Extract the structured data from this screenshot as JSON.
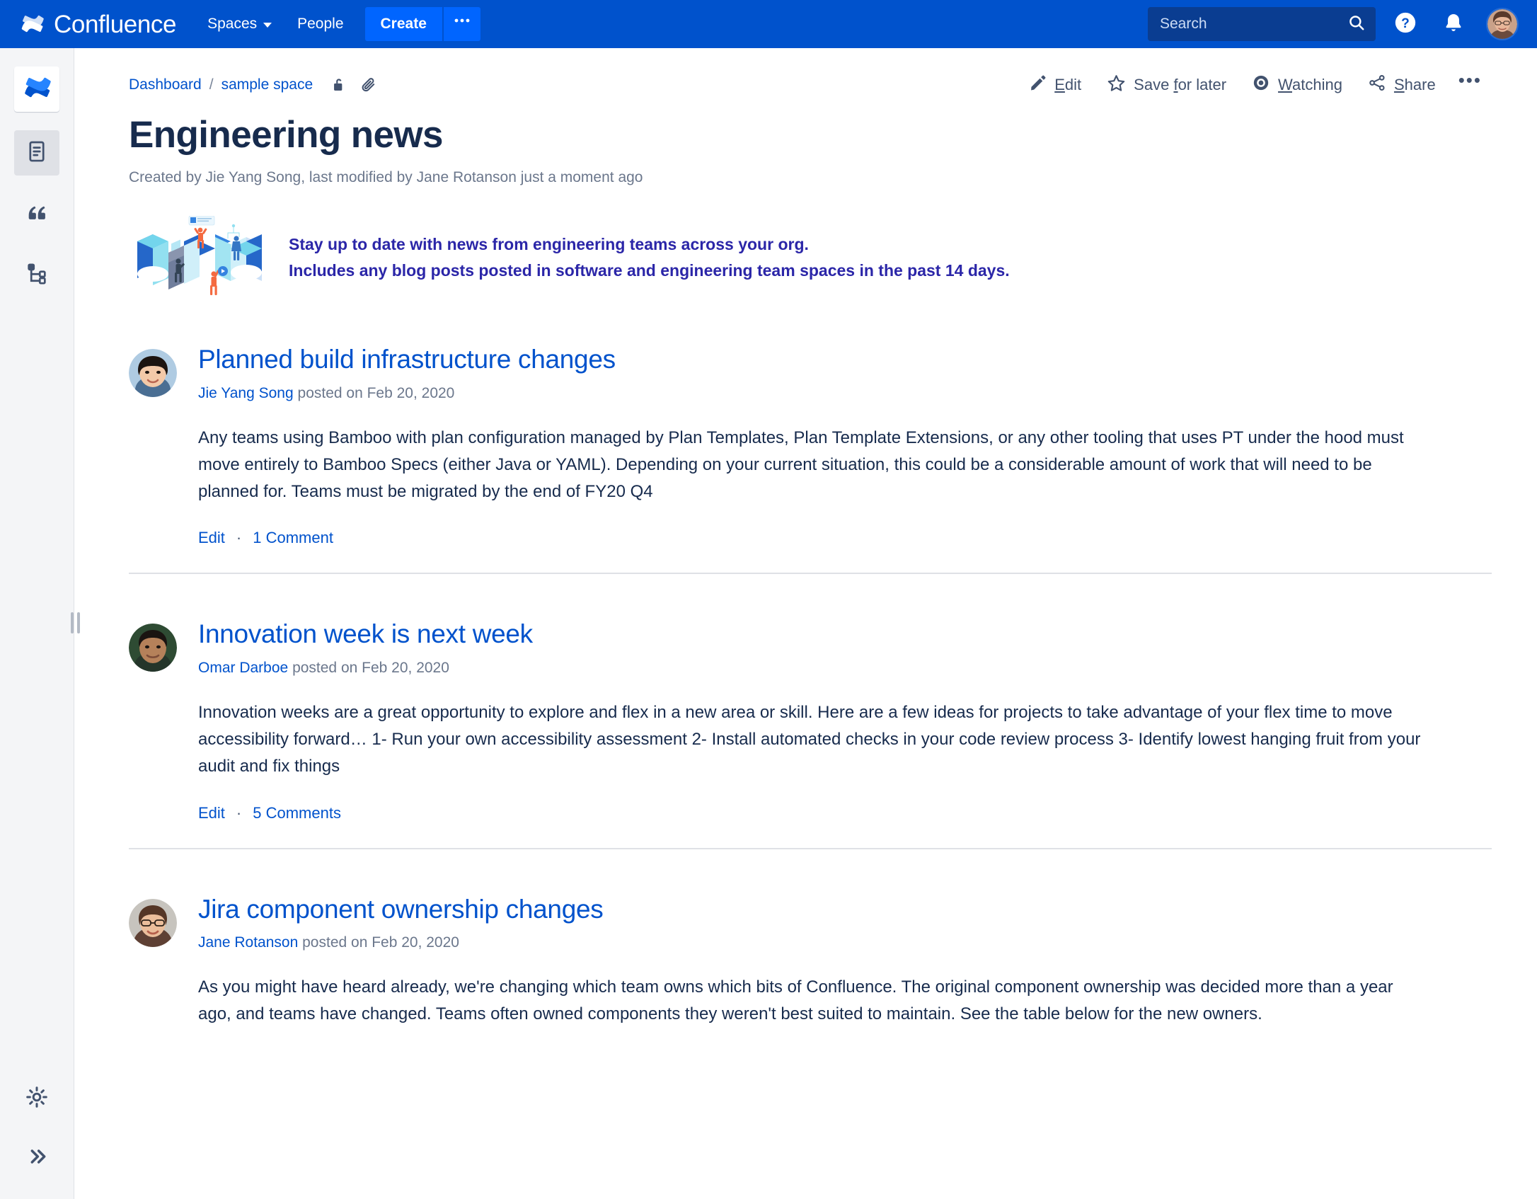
{
  "topnav": {
    "product_name": "Confluence",
    "logo_icon": "confluence-logo-icon",
    "items": [
      {
        "label": "Spaces",
        "has_chevron": true,
        "icon": "chevron-down-icon"
      },
      {
        "label": "People",
        "has_chevron": false
      }
    ],
    "create_label": "Create",
    "create_more_label": "•••",
    "search": {
      "placeholder": "Search",
      "value": "",
      "icon": "search-icon"
    },
    "help_icon": "help-circle-icon",
    "notifications_icon": "notification-bell-icon",
    "avatar_icon": "user-avatar",
    "colors": {
      "bar": "#0052CC",
      "create": "#0065FF",
      "search_field": "#0A3D91"
    }
  },
  "sidebar": {
    "items": [
      {
        "name": "space-home",
        "icon": "confluence-space-logo-icon",
        "selected": false
      },
      {
        "name": "pages",
        "icon": "page-document-icon",
        "selected": true
      },
      {
        "name": "blog",
        "icon": "blog-quote-icon",
        "selected": false
      },
      {
        "name": "page-tree",
        "icon": "page-tree-icon",
        "selected": false
      }
    ],
    "bottom_items": [
      {
        "name": "space-settings",
        "icon": "gear-icon"
      },
      {
        "name": "expand-sidebar",
        "icon": "double-chevron-right-icon"
      }
    ],
    "resize_handle": "sidebar-resize-handle"
  },
  "breadcrumb": {
    "dashboard": "Dashboard",
    "separator": "/",
    "space": "sample space",
    "restrictions_icon": "unlock-icon",
    "attachments_icon": "paperclip-icon"
  },
  "page_actions": [
    {
      "name": "edit",
      "label": "Edit",
      "accesskey": "E",
      "icon": "pencil-icon"
    },
    {
      "name": "save-for-later",
      "label": "Save for later",
      "accesskey": "f",
      "icon": "star-icon"
    },
    {
      "name": "watching",
      "label": "Watching",
      "accesskey": "W",
      "icon": "eye-icon"
    },
    {
      "name": "share",
      "label": "Share",
      "accesskey": "S",
      "icon": "share-icon"
    },
    {
      "name": "more",
      "label": "•••",
      "icon": "more-horizontal-icon"
    }
  ],
  "page": {
    "title": "Engineering news",
    "byline": "Created by Jie Yang Song, last modified by Jane Rotanson just a moment ago"
  },
  "banner": {
    "illustration": "teamwork-isometric-illustration",
    "line1": "Stay up to date with news from engineering teams across your org.",
    "line2": "Includes any blog posts posted in software and engineering team spaces in the past 14 days.",
    "text_color": "#2B26A8"
  },
  "posts": [
    {
      "avatar": "avatar-jie-yang-song",
      "title": "Planned build infrastructure changes",
      "author": "Jie Yang Song",
      "meta_suffix": "posted on Feb 20, 2020",
      "body": "Any teams using Bamboo with plan configuration managed by Plan Templates, Plan Template Extensions, or any other tooling that uses PT under the hood must move entirely to Bamboo Specs (either Java or YAML). Depending on your current situation, this could be a considerable amount of work that will need to be planned for. Teams must be migrated by the end of FY20 Q4",
      "edit_label": "Edit",
      "separator": "·",
      "comments_label": "1 Comment"
    },
    {
      "avatar": "avatar-omar-darboe",
      "title": "Innovation week is next week",
      "author": "Omar Darboe",
      "meta_suffix": "posted on Feb 20, 2020",
      "body": "Innovation weeks are a great opportunity to explore and flex in a new area or skill. Here are a few ideas for projects to take advantage of your flex time to move accessibility forward… 1- Run your own accessibility assessment 2- Install automated checks in your code review process 3- Identify lowest hanging fruit from your audit and fix things",
      "edit_label": "Edit",
      "separator": "·",
      "comments_label": "5 Comments"
    },
    {
      "avatar": "avatar-jane-rotanson",
      "title": "Jira component ownership changes",
      "author": "Jane Rotanson",
      "meta_suffix": "posted on Feb 20, 2020",
      "body": "As you might have heard already, we're changing which team owns which bits of Confluence.  The original component ownership was decided more than a year ago, and teams have changed. Teams often owned components they weren't best suited to maintain. See the table below for the new owners.",
      "edit_label": "",
      "separator": "",
      "comments_label": ""
    }
  ]
}
